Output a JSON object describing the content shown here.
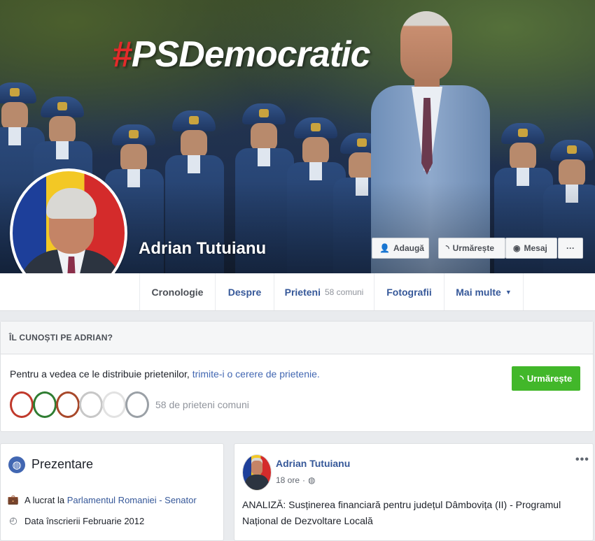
{
  "cover": {
    "hashtag_symbol": "#",
    "hashtag_text": "PSDemocratic"
  },
  "profile": {
    "name": "Adrian Tutuianu"
  },
  "actions": {
    "add_label": "Adaugă",
    "follow_label": "Urmărește",
    "message_label": "Mesaj",
    "more_label": "···"
  },
  "tabs": [
    {
      "label": "Cronologie",
      "active": true
    },
    {
      "label": "Despre"
    },
    {
      "label": "Prieteni",
      "count": "58 comuni"
    },
    {
      "label": "Fotografii"
    },
    {
      "label": "Mai multe",
      "caret": "▼"
    }
  ],
  "know_card": {
    "title": "ÎL CUNOȘTI PE ADRIAN?",
    "text_prefix": "Pentru a vedea ce le distribuie prietenilor, ",
    "text_link": "trimite-i o cerere de prietenie.",
    "follow_label": "Urmărește",
    "mutual_friends": "58 de prieteni comuni",
    "friend_colors": [
      "#c0392b",
      "#2f7d32",
      "#a8482a",
      "#c7c7c7",
      "#e2e2e2",
      "#9aa0a6"
    ]
  },
  "intro": {
    "title": "Prezentare",
    "work_prefix": "A lucrat la ",
    "work_link": "Parlamentul Romaniei - Senator",
    "joined": "Data înscrierii Februarie 2012"
  },
  "post": {
    "author": "Adrian Tutuianu",
    "time": "18 ore",
    "separator": "·",
    "more": "•••",
    "text": "ANALIZĂ: Susținerea financiară pentru județul Dâmbovița (II) - Programul Național de Dezvoltare Locală"
  },
  "colors": {
    "link": "#365899",
    "accent_green": "#42b72a",
    "hashtag_red": "#e32a2a",
    "page_bg": "#e9ebee"
  },
  "icons": {
    "add": "add-friend-icon",
    "follow": "rss-icon",
    "message": "messenger-icon",
    "intro": "globe-icon",
    "work": "briefcase-icon",
    "joined": "clock-icon",
    "privacy": "globe-small-icon"
  }
}
